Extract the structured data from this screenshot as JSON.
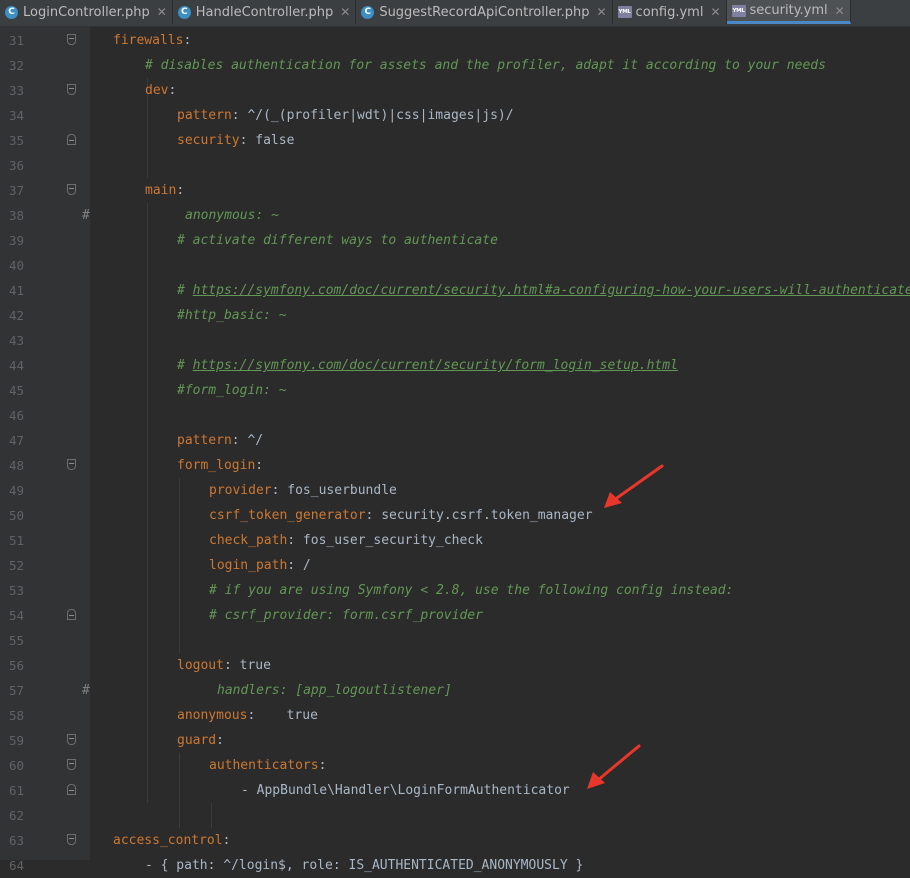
{
  "tabs": [
    {
      "label": "LoginController.php",
      "icon": "php-class-icon",
      "active": false
    },
    {
      "label": "HandleController.php",
      "icon": "php-class-icon",
      "active": false
    },
    {
      "label": "SuggestRecordApiController.php",
      "icon": "php-class-icon",
      "active": false
    },
    {
      "label": "config.yml",
      "icon": "yml-file-icon",
      "active": false
    },
    {
      "label": "security.yml",
      "icon": "yml-file-icon",
      "active": true
    }
  ],
  "tab_icon_letter": "C",
  "yml_icon_text": "YML",
  "close_glyph": "✕",
  "lines": [
    {
      "n": "31",
      "indent": 0,
      "fold": "open",
      "parts": [
        [
          "key",
          "firewalls"
        ],
        [
          "val",
          ":"
        ]
      ]
    },
    {
      "n": "32",
      "indent": 1,
      "parts": [
        [
          "cmt",
          "# disables authentication for assets and the profiler, adapt it according to your needs"
        ]
      ]
    },
    {
      "n": "33",
      "indent": 1,
      "fold": "open",
      "parts": [
        [
          "key",
          "dev"
        ],
        [
          "val",
          ":"
        ]
      ]
    },
    {
      "n": "34",
      "indent": 2,
      "parts": [
        [
          "key",
          "pattern"
        ],
        [
          "val",
          ": ^/(_(profiler|wdt)|css|images|js)/"
        ]
      ]
    },
    {
      "n": "35",
      "indent": 2,
      "fold": "close",
      "parts": [
        [
          "key",
          "security"
        ],
        [
          "val",
          ": false"
        ]
      ]
    },
    {
      "n": "36",
      "indent": 0,
      "parts": []
    },
    {
      "n": "37",
      "indent": 1,
      "fold": "open",
      "parts": [
        [
          "key",
          "main"
        ],
        [
          "val",
          ":"
        ]
      ]
    },
    {
      "n": "38",
      "indent": 2,
      "mark": "#",
      "offset": 8,
      "parts": [
        [
          "cmt",
          "anonymous: ~"
        ]
      ]
    },
    {
      "n": "39",
      "indent": 2,
      "parts": [
        [
          "cmt",
          "# activate different ways to authenticate"
        ]
      ]
    },
    {
      "n": "40",
      "indent": 0,
      "parts": []
    },
    {
      "n": "41",
      "indent": 2,
      "parts": [
        [
          "cmt",
          "# "
        ],
        [
          "url",
          "https://symfony.com/doc/current/security.html#a-configuring-how-your-users-will-authenticate"
        ]
      ]
    },
    {
      "n": "42",
      "indent": 2,
      "parts": [
        [
          "cmt",
          "#http_basic: ~"
        ]
      ]
    },
    {
      "n": "43",
      "indent": 0,
      "parts": []
    },
    {
      "n": "44",
      "indent": 2,
      "parts": [
        [
          "cmt",
          "# "
        ],
        [
          "url",
          "https://symfony.com/doc/current/security/form_login_setup.html"
        ]
      ]
    },
    {
      "n": "45",
      "indent": 2,
      "parts": [
        [
          "cmt",
          "#form_login: ~"
        ]
      ]
    },
    {
      "n": "46",
      "indent": 0,
      "parts": []
    },
    {
      "n": "47",
      "indent": 2,
      "parts": [
        [
          "key",
          "pattern"
        ],
        [
          "val",
          ": ^/"
        ]
      ]
    },
    {
      "n": "48",
      "indent": 2,
      "fold": "open",
      "parts": [
        [
          "key",
          "form_login"
        ],
        [
          "val",
          ":"
        ]
      ]
    },
    {
      "n": "49",
      "indent": 3,
      "parts": [
        [
          "key",
          "provider"
        ],
        [
          "val",
          ": fos_userbundle"
        ]
      ]
    },
    {
      "n": "50",
      "indent": 3,
      "parts": [
        [
          "key",
          "csrf_token_generator"
        ],
        [
          "val",
          ": security.csrf.token_manager"
        ]
      ]
    },
    {
      "n": "51",
      "indent": 3,
      "parts": [
        [
          "key",
          "check_path"
        ],
        [
          "val",
          ": fos_user_security_check"
        ]
      ]
    },
    {
      "n": "52",
      "indent": 3,
      "parts": [
        [
          "key",
          "login_path"
        ],
        [
          "val",
          ": /"
        ]
      ]
    },
    {
      "n": "53",
      "indent": 3,
      "parts": [
        [
          "cmt",
          "# if you are using Symfony < 2.8, use the following config instead:"
        ]
      ]
    },
    {
      "n": "54",
      "indent": 3,
      "fold": "close",
      "parts": [
        [
          "cmt",
          "# csrf_provider: form.csrf_provider"
        ]
      ]
    },
    {
      "n": "55",
      "indent": 0,
      "parts": []
    },
    {
      "n": "56",
      "indent": 2,
      "parts": [
        [
          "key",
          "logout"
        ],
        [
          "val",
          ": true"
        ]
      ]
    },
    {
      "n": "57",
      "indent": 3,
      "mark": "#",
      "offset": 8,
      "parts": [
        [
          "cmt",
          "handlers: [app_logoutlistener]"
        ]
      ]
    },
    {
      "n": "58",
      "indent": 2,
      "parts": [
        [
          "key",
          "anonymous"
        ],
        [
          "val",
          ":    true"
        ]
      ]
    },
    {
      "n": "59",
      "indent": 2,
      "fold": "open",
      "parts": [
        [
          "key",
          "guard"
        ],
        [
          "val",
          ":"
        ]
      ]
    },
    {
      "n": "60",
      "indent": 3,
      "fold": "open",
      "parts": [
        [
          "key",
          "authenticators"
        ],
        [
          "val",
          ":"
        ]
      ]
    },
    {
      "n": "61",
      "indent": 4,
      "fold": "close",
      "parts": [
        [
          "val",
          "- AppBundle\\Handler\\LoginFormAuthenticator"
        ]
      ]
    },
    {
      "n": "62",
      "indent": 0,
      "parts": []
    },
    {
      "n": "63",
      "indent": 0,
      "fold": "open",
      "parts": [
        [
          "key",
          "access_control"
        ],
        [
          "val",
          ":"
        ]
      ]
    },
    {
      "n": "64",
      "indent": 1,
      "parts": [
        [
          "val",
          "- { path: ^/login$, role: IS_AUTHENTICATED_ANONYMOUSLY }"
        ]
      ]
    }
  ]
}
